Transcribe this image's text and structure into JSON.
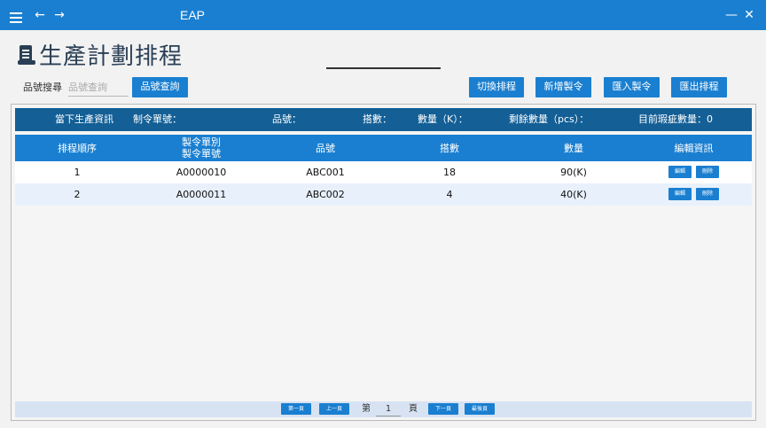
{
  "window": {
    "title": "EAP",
    "minimize_glyph": "—",
    "close_glyph": "✕",
    "back_glyph": "←",
    "forward_glyph": "→"
  },
  "page": {
    "title": "生產計劃排程"
  },
  "search": {
    "label": "品號搜尋",
    "placeholder": "品號查詢",
    "button": "品號查詢"
  },
  "actions": {
    "switch": "切換排程",
    "add": "新增製令",
    "import": "匯入製令",
    "export": "匯出排程"
  },
  "info_bar": {
    "current": "當下生產資訊",
    "order_no": "制令單號：",
    "part_no": "品號：",
    "tray": "搭數：",
    "quantity": "數量（K）：",
    "remaining": "剩餘數量（pcs）：",
    "defect": "目前瑕疵數量：",
    "defect_value": "0"
  },
  "table": {
    "headers": {
      "order": "排程順序",
      "order_type": "製令單別",
      "order_no": "製令單號",
      "part": "品號",
      "tray": "搭數",
      "qty": "數量",
      "edit": "編輯資訊"
    },
    "rows": [
      {
        "order": "1",
        "order_no": "A0000010",
        "part": "ABC001",
        "tray": "18",
        "qty": "90(K)"
      },
      {
        "order": "2",
        "order_no": "A0000011",
        "part": "ABC002",
        "tray": "4",
        "qty": "40(K)"
      }
    ],
    "edit_label": "編輯",
    "delete_label": "刪除"
  },
  "pager": {
    "first": "第一頁",
    "prev": "上一頁",
    "prefix": "第",
    "current": "1",
    "suffix": "頁",
    "next": "下一頁",
    "last": "最後頁"
  },
  "colors": {
    "titlebar": "#1a7fd0",
    "info_bar": "#135f96",
    "accent": "#1a7fd0"
  }
}
